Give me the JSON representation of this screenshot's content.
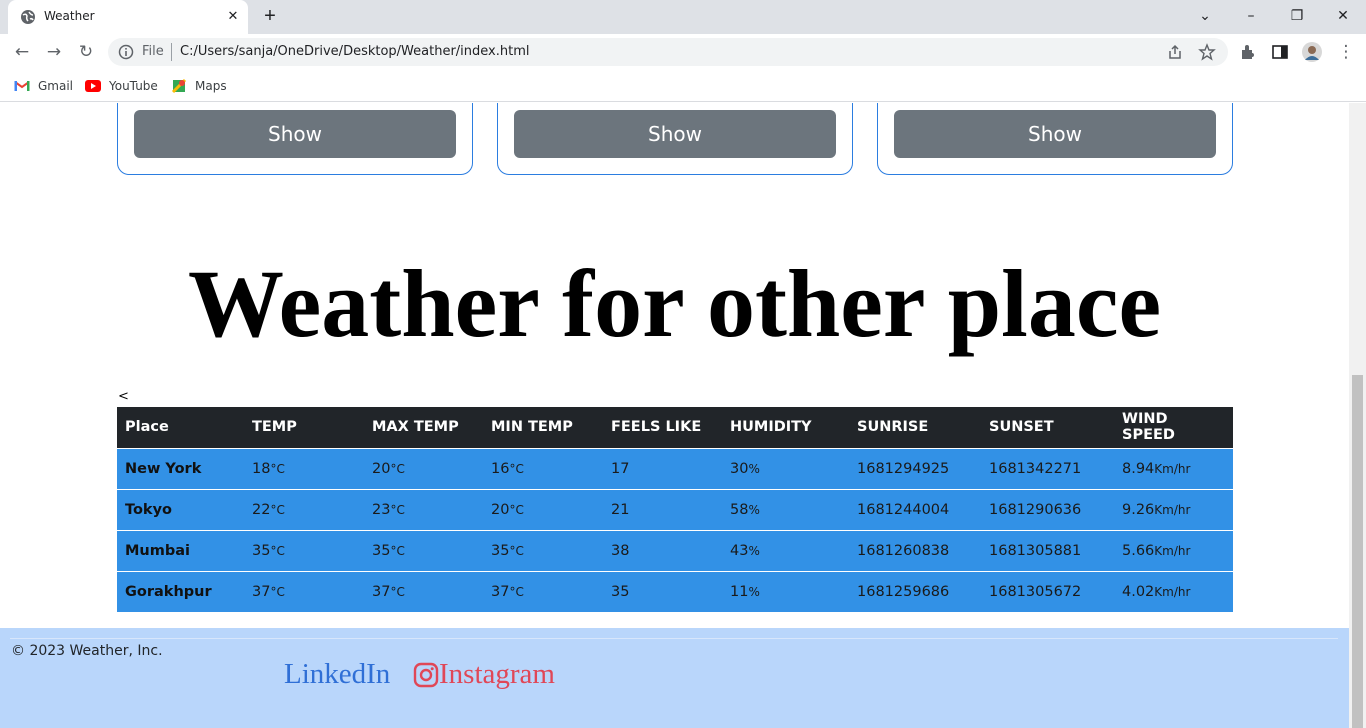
{
  "browser": {
    "tab_title": "Weather",
    "new_tab": "+",
    "file_label": "File",
    "url": "C:/Users/sanja/OneDrive/Desktop/Weather/index.html",
    "bookmarks": [
      {
        "label": "Gmail",
        "icon": "gmail-icon"
      },
      {
        "label": "YouTube",
        "icon": "youtube-icon"
      },
      {
        "label": "Maps",
        "icon": "maps-icon"
      }
    ]
  },
  "cards": [
    {
      "button": "Show"
    },
    {
      "button": "Show"
    },
    {
      "button": "Show"
    }
  ],
  "heading": "Weather for other place",
  "stray_text": "<",
  "table": {
    "headers": [
      "Place",
      "TEMP",
      "MAX TEMP",
      "MIN TEMP",
      "FEELS LIKE",
      "HUMIDITY",
      "SUNRISE",
      "SUNSET",
      "WIND SPEED"
    ],
    "rows": [
      {
        "place": "New York",
        "temp": "18",
        "max": "20",
        "min": "16",
        "feels": "17",
        "humidity": "30",
        "sunrise": "1681294925",
        "sunset": "1681342271",
        "wind": "8.94"
      },
      {
        "place": "Tokyo",
        "temp": "22",
        "max": "23",
        "min": "20",
        "feels": "21",
        "humidity": "58",
        "sunrise": "1681244004",
        "sunset": "1681290636",
        "wind": "9.26"
      },
      {
        "place": "Mumbai",
        "temp": "35",
        "max": "35",
        "min": "35",
        "feels": "38",
        "humidity": "43",
        "sunrise": "1681260838",
        "sunset": "1681305881",
        "wind": "5.66"
      },
      {
        "place": "Gorakhpur",
        "temp": "37",
        "max": "37",
        "min": "37",
        "feels": "35",
        "humidity": "11",
        "sunrise": "1681259686",
        "sunset": "1681305672",
        "wind": "4.02"
      }
    ],
    "units": {
      "temp": "°C",
      "humidity": "%",
      "wind": "Km/hr"
    }
  },
  "footer": {
    "copyright": "© 2023 Weather, Inc.",
    "linkedin": "LinkedIn",
    "instagram": "Instagram"
  },
  "colors": {
    "table_header": "#212529",
    "table_row": "#3291e6",
    "show_button": "#6c757d",
    "footer_bg": "#b9d6fb",
    "linkedin": "#2f6fd6",
    "instagram": "#e04757"
  }
}
